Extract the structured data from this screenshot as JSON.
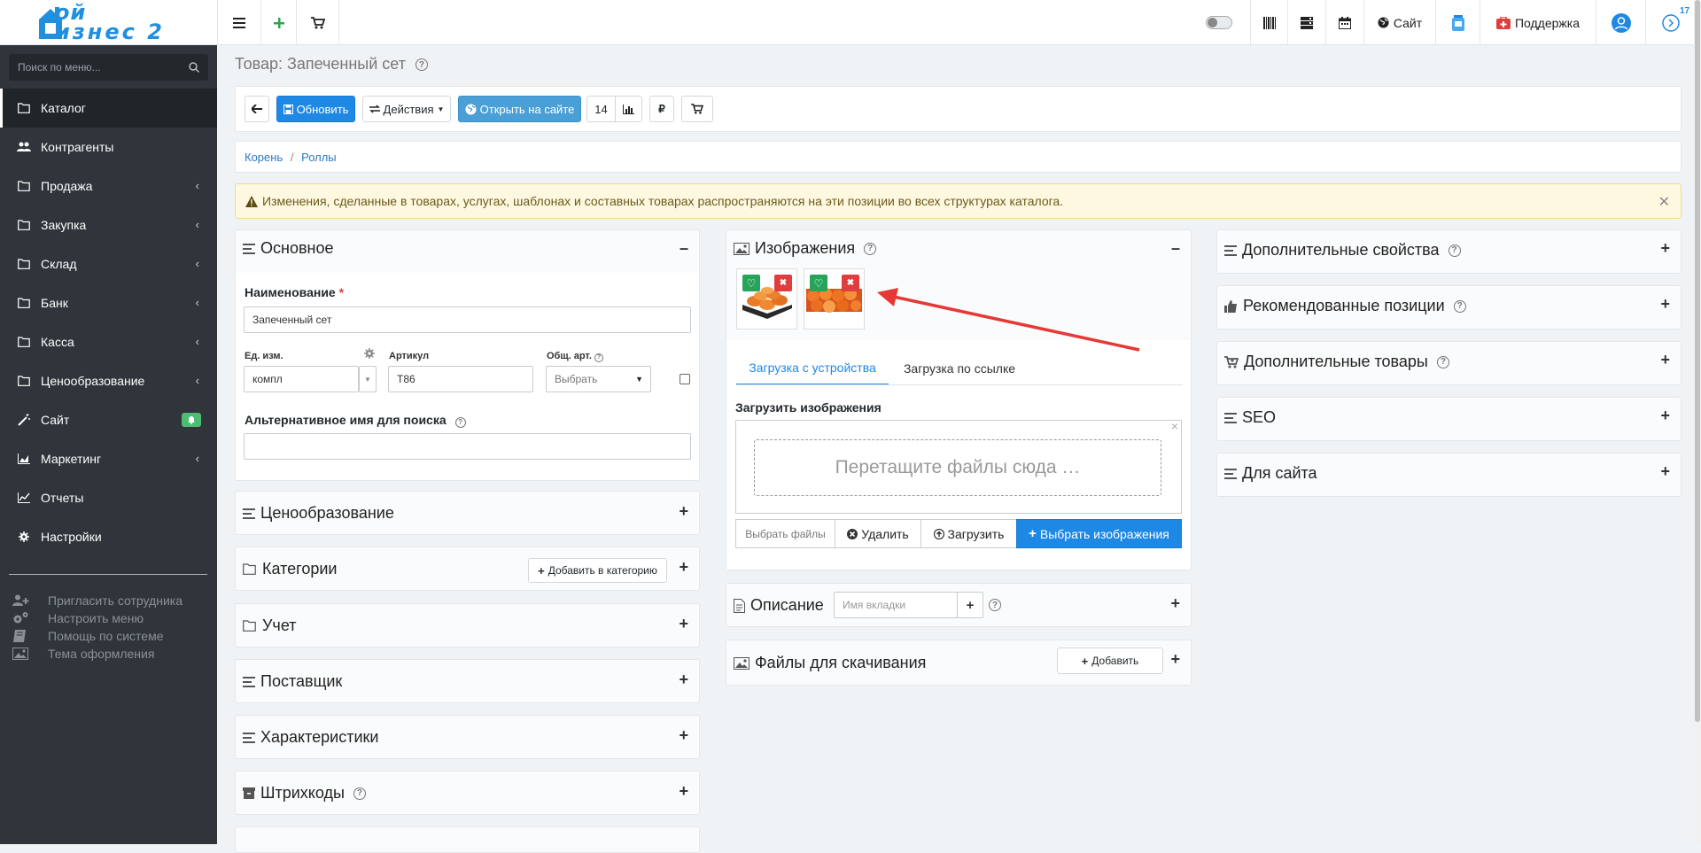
{
  "topbar": {
    "logo_line1": "ой",
    "logo_line2": "изнес 2",
    "site_label": "Сайт",
    "support_label": "Поддержка",
    "notifications_count": "17"
  },
  "sidebar": {
    "search_placeholder": "Поиск по меню...",
    "items": [
      {
        "label": "Каталог"
      },
      {
        "label": "Контрагенты"
      },
      {
        "label": "Продажа"
      },
      {
        "label": "Закупка"
      },
      {
        "label": "Склад"
      },
      {
        "label": "Банк"
      },
      {
        "label": "Касса"
      },
      {
        "label": "Ценообразование"
      },
      {
        "label": "Сайт"
      },
      {
        "label": "Маркетинг"
      },
      {
        "label": "Отчеты"
      },
      {
        "label": "Настройки"
      }
    ],
    "extras": [
      {
        "label": "Пригласить сотрудника"
      },
      {
        "label": "Настроить меню"
      },
      {
        "label": "Помощь по системе"
      },
      {
        "label": "Тема оформления"
      }
    ]
  },
  "page": {
    "title": "Товар: Запеченный сет"
  },
  "toolbar": {
    "update_label": "Обновить",
    "actions_label": "Действия",
    "open_site_label": "Открыть на сайте",
    "count": "14"
  },
  "breadcrumb": {
    "root": "Корень",
    "separator": "/",
    "current": "Роллы"
  },
  "alert": {
    "text": "Изменения, сделанные в товарах, услугах, шаблонах и составных товарах распространяются на эти позиции во всех структурах каталога."
  },
  "basic": {
    "title": "Основное",
    "name_label": "Наименование",
    "required_mark": "*",
    "name_value": "Запеченный сет",
    "unit_label": "Ед. изм.",
    "unit_value": "компл",
    "article_label": "Артикул",
    "article_value": "Т86",
    "common_article_label": "Общ. арт.",
    "common_article_value": "Выбрать",
    "alt_name_label": "Альтернативное имя для поиска"
  },
  "left_panels": [
    {
      "title": "Ценообразование"
    },
    {
      "title": "Категории",
      "button": "Добавить в категорию"
    },
    {
      "title": "Учет"
    },
    {
      "title": "Поставщик"
    },
    {
      "title": "Характеристики"
    },
    {
      "title": "Штрихкоды"
    }
  ],
  "images": {
    "title": "Изображения",
    "tab_device": "Загрузка с устройства",
    "tab_link": "Загрузка по ссылке",
    "upload_label": "Загрузить изображения",
    "dropzone_text": "Перетащите файлы сюда …",
    "choose_files": "Выбрать файлы",
    "delete": "Удалить",
    "upload": "Загрузить",
    "select_images": "Выбрать изображения"
  },
  "description": {
    "title": "Описание",
    "tab_placeholder": "Имя вкладки"
  },
  "downloads": {
    "title": "Файлы для скачивания",
    "add": "Добавить"
  },
  "right_panels": [
    {
      "title": "Дополнительные свойства"
    },
    {
      "title": "Рекомендованные позиции"
    },
    {
      "title": "Дополнительные товары"
    },
    {
      "title": "SEO"
    },
    {
      "title": "Для сайта"
    }
  ],
  "colors": {
    "sidebar_bg": "#2f353a",
    "primary": "#1e88e5",
    "success": "#4dbd74",
    "danger": "#e03e3e",
    "annotation_arrow": "#e53935"
  }
}
